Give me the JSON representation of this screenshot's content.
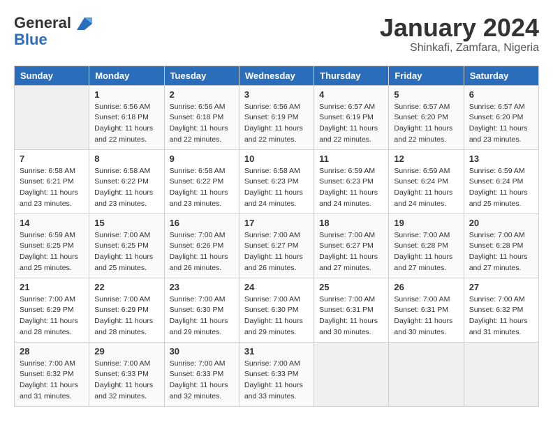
{
  "header": {
    "logo_line1": "General",
    "logo_line2": "Blue",
    "month_year": "January 2024",
    "location": "Shinkafi, Zamfara, Nigeria"
  },
  "days_of_week": [
    "Sunday",
    "Monday",
    "Tuesday",
    "Wednesday",
    "Thursday",
    "Friday",
    "Saturday"
  ],
  "weeks": [
    [
      {
        "day": "",
        "info": ""
      },
      {
        "day": "1",
        "info": "Sunrise: 6:56 AM\nSunset: 6:18 PM\nDaylight: 11 hours\nand 22 minutes."
      },
      {
        "day": "2",
        "info": "Sunrise: 6:56 AM\nSunset: 6:18 PM\nDaylight: 11 hours\nand 22 minutes."
      },
      {
        "day": "3",
        "info": "Sunrise: 6:56 AM\nSunset: 6:19 PM\nDaylight: 11 hours\nand 22 minutes."
      },
      {
        "day": "4",
        "info": "Sunrise: 6:57 AM\nSunset: 6:19 PM\nDaylight: 11 hours\nand 22 minutes."
      },
      {
        "day": "5",
        "info": "Sunrise: 6:57 AM\nSunset: 6:20 PM\nDaylight: 11 hours\nand 22 minutes."
      },
      {
        "day": "6",
        "info": "Sunrise: 6:57 AM\nSunset: 6:20 PM\nDaylight: 11 hours\nand 23 minutes."
      }
    ],
    [
      {
        "day": "7",
        "info": "Sunrise: 6:58 AM\nSunset: 6:21 PM\nDaylight: 11 hours\nand 23 minutes."
      },
      {
        "day": "8",
        "info": "Sunrise: 6:58 AM\nSunset: 6:22 PM\nDaylight: 11 hours\nand 23 minutes."
      },
      {
        "day": "9",
        "info": "Sunrise: 6:58 AM\nSunset: 6:22 PM\nDaylight: 11 hours\nand 23 minutes."
      },
      {
        "day": "10",
        "info": "Sunrise: 6:58 AM\nSunset: 6:23 PM\nDaylight: 11 hours\nand 24 minutes."
      },
      {
        "day": "11",
        "info": "Sunrise: 6:59 AM\nSunset: 6:23 PM\nDaylight: 11 hours\nand 24 minutes."
      },
      {
        "day": "12",
        "info": "Sunrise: 6:59 AM\nSunset: 6:24 PM\nDaylight: 11 hours\nand 24 minutes."
      },
      {
        "day": "13",
        "info": "Sunrise: 6:59 AM\nSunset: 6:24 PM\nDaylight: 11 hours\nand 25 minutes."
      }
    ],
    [
      {
        "day": "14",
        "info": "Sunrise: 6:59 AM\nSunset: 6:25 PM\nDaylight: 11 hours\nand 25 minutes."
      },
      {
        "day": "15",
        "info": "Sunrise: 7:00 AM\nSunset: 6:25 PM\nDaylight: 11 hours\nand 25 minutes."
      },
      {
        "day": "16",
        "info": "Sunrise: 7:00 AM\nSunset: 6:26 PM\nDaylight: 11 hours\nand 26 minutes."
      },
      {
        "day": "17",
        "info": "Sunrise: 7:00 AM\nSunset: 6:27 PM\nDaylight: 11 hours\nand 26 minutes."
      },
      {
        "day": "18",
        "info": "Sunrise: 7:00 AM\nSunset: 6:27 PM\nDaylight: 11 hours\nand 27 minutes."
      },
      {
        "day": "19",
        "info": "Sunrise: 7:00 AM\nSunset: 6:28 PM\nDaylight: 11 hours\nand 27 minutes."
      },
      {
        "day": "20",
        "info": "Sunrise: 7:00 AM\nSunset: 6:28 PM\nDaylight: 11 hours\nand 27 minutes."
      }
    ],
    [
      {
        "day": "21",
        "info": "Sunrise: 7:00 AM\nSunset: 6:29 PM\nDaylight: 11 hours\nand 28 minutes."
      },
      {
        "day": "22",
        "info": "Sunrise: 7:00 AM\nSunset: 6:29 PM\nDaylight: 11 hours\nand 28 minutes."
      },
      {
        "day": "23",
        "info": "Sunrise: 7:00 AM\nSunset: 6:30 PM\nDaylight: 11 hours\nand 29 minutes."
      },
      {
        "day": "24",
        "info": "Sunrise: 7:00 AM\nSunset: 6:30 PM\nDaylight: 11 hours\nand 29 minutes."
      },
      {
        "day": "25",
        "info": "Sunrise: 7:00 AM\nSunset: 6:31 PM\nDaylight: 11 hours\nand 30 minutes."
      },
      {
        "day": "26",
        "info": "Sunrise: 7:00 AM\nSunset: 6:31 PM\nDaylight: 11 hours\nand 30 minutes."
      },
      {
        "day": "27",
        "info": "Sunrise: 7:00 AM\nSunset: 6:32 PM\nDaylight: 11 hours\nand 31 minutes."
      }
    ],
    [
      {
        "day": "28",
        "info": "Sunrise: 7:00 AM\nSunset: 6:32 PM\nDaylight: 11 hours\nand 31 minutes."
      },
      {
        "day": "29",
        "info": "Sunrise: 7:00 AM\nSunset: 6:33 PM\nDaylight: 11 hours\nand 32 minutes."
      },
      {
        "day": "30",
        "info": "Sunrise: 7:00 AM\nSunset: 6:33 PM\nDaylight: 11 hours\nand 32 minutes."
      },
      {
        "day": "31",
        "info": "Sunrise: 7:00 AM\nSunset: 6:33 PM\nDaylight: 11 hours\nand 33 minutes."
      },
      {
        "day": "",
        "info": ""
      },
      {
        "day": "",
        "info": ""
      },
      {
        "day": "",
        "info": ""
      }
    ]
  ]
}
